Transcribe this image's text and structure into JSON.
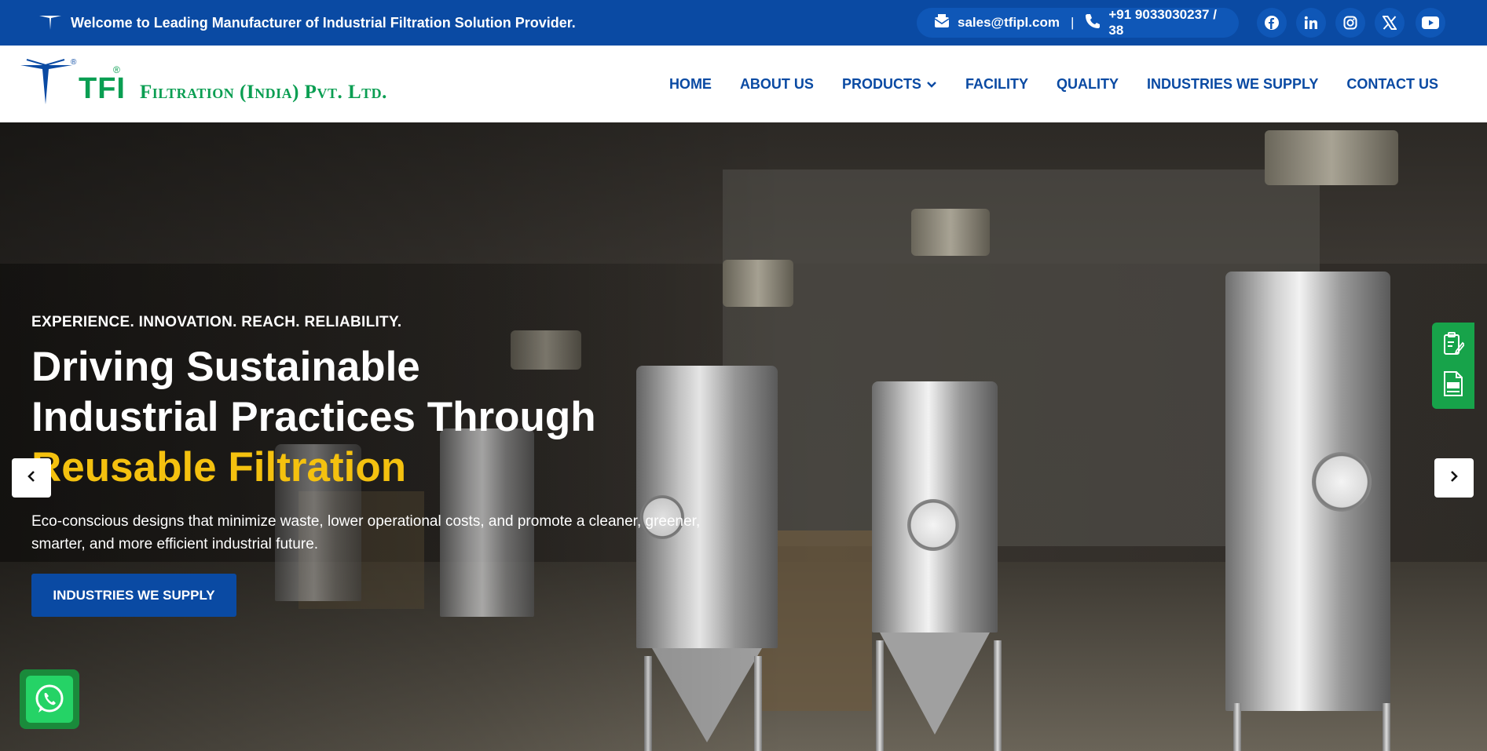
{
  "topbar": {
    "welcome": "Welcome to Leading Manufacturer of Industrial Filtration Solution Provider.",
    "email": "sales@tfipl.com",
    "separator": "|",
    "phone": "+91 9033030237 / 38",
    "social": [
      "facebook-icon",
      "linkedin-icon",
      "instagram-icon",
      "x-icon",
      "youtube-icon"
    ]
  },
  "header": {
    "logo_mark": "TFI",
    "logo_registered": "®",
    "company_name": "Filtration (India) Pvt. Ltd.",
    "nav": {
      "home": "HOME",
      "about": "ABOUT US",
      "products": "PRODUCTS",
      "facility": "FACILITY",
      "quality": "QUALITY",
      "industries": "INDUSTRIES WE SUPPLY",
      "contact": "CONTACT US"
    }
  },
  "hero": {
    "eyebrow": "EXPERIENCE. INNOVATION. REACH. RELIABILITY.",
    "headline_line1": "Driving Sustainable",
    "headline_line2": "Industrial Practices Through",
    "headline_accent": "Reusable Filtration",
    "subtext": "Eco-conscious designs that minimize waste, lower operational costs, and promote a cleaner, greener, smarter, and more efficient industrial future.",
    "cta_label": "INDUSTRIES WE SUPPLY"
  },
  "colors": {
    "brand_blue": "#0a4aa3",
    "brand_green": "#0a9e52",
    "accent_yellow": "#f4c10f",
    "whatsapp_green": "#25d366"
  }
}
